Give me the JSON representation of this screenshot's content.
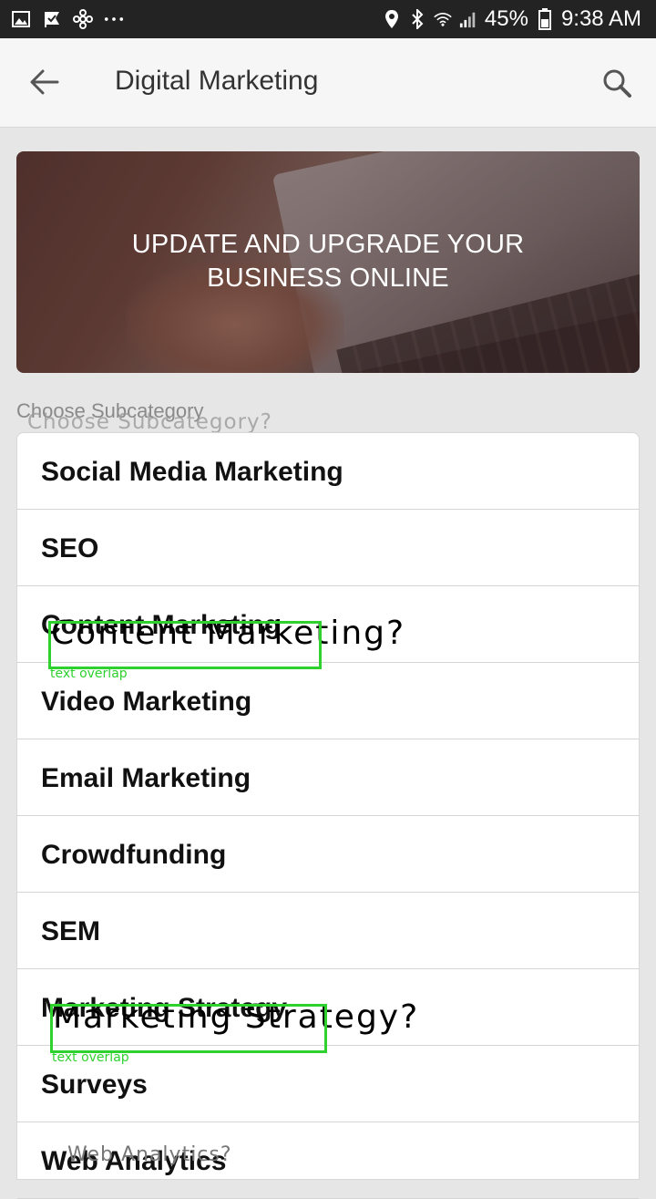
{
  "status_bar": {
    "battery": "45%",
    "time": "9:38 AM",
    "icons_left": [
      "image-icon",
      "check-flag-icon",
      "fan-icon",
      "more-dots-icon"
    ],
    "icons_right": [
      "location-icon",
      "bluetooth-icon",
      "wifi-icon",
      "signal-icon",
      "battery-icon"
    ]
  },
  "app_bar": {
    "title": "Digital Marketing",
    "back_icon": "arrow-left-icon",
    "search_icon": "search-icon"
  },
  "banner": {
    "headline_line1": "UPDATE AND UPGRADE YOUR",
    "headline_line2": "BUSINESS ONLINE"
  },
  "section": {
    "label": "Choose Subcategory"
  },
  "subcategories": [
    "Social Media Marketing",
    "SEO",
    "Content Marketing",
    "Video Marketing",
    "Email Marketing",
    "Crowdfunding",
    "SEM",
    "Marketing Strategy",
    "Surveys",
    "Web Analytics"
  ],
  "overlays": {
    "choose_question": "Choose Subcategory?",
    "content_question": "Content Marketing?",
    "strategy_question": "Marketing Strategy?",
    "analytics_question": "Web Analytics?",
    "tag": "text overlap"
  },
  "colors": {
    "status_bar": "#232323",
    "app_bar": "#f6f6f6",
    "background": "#e6e6e6",
    "overlay_box": "#2fd12f"
  }
}
